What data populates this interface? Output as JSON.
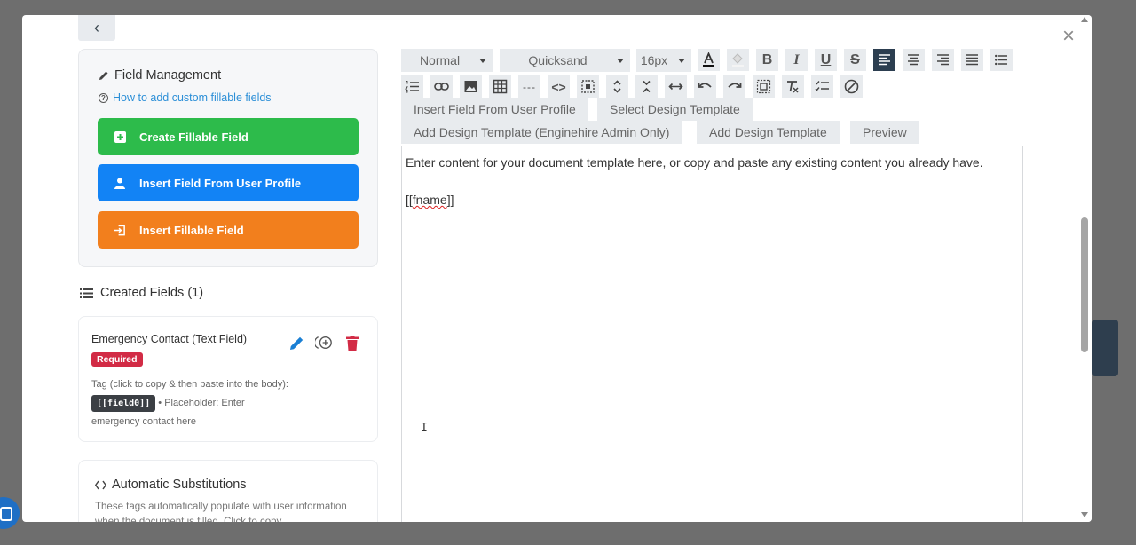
{
  "field_management": {
    "title": "Field Management",
    "help_link": "How to add custom fillable fields",
    "buttons": {
      "create": "Create Fillable Field",
      "insert_profile": "Insert Field From User Profile",
      "insert_fillable": "Insert Fillable Field"
    }
  },
  "created_fields": {
    "heading": "Created Fields (1)",
    "items": [
      {
        "name": "Emergency Contact (Text Field)",
        "badge": "Required",
        "desc_prefix": "Tag (click to copy & then paste into the body):",
        "tag": "[[field0]]",
        "desc_suffix": "• Placeholder: Enter emergency contact here"
      }
    ]
  },
  "substitutions": {
    "title": "Automatic Substitutions",
    "desc": "These tags automatically populate with user information when the document is filled. Click to copy"
  },
  "toolbar": {
    "format": "Normal",
    "font": "Quicksand",
    "size": "16px",
    "bold_glyph": "B",
    "italic_glyph": "I",
    "underline_glyph": "U",
    "strike_glyph": "S",
    "hr_glyph": "---",
    "code_glyph": "<>"
  },
  "tabs": {
    "insert_profile": "Insert Field From User Profile",
    "select_design": "Select Design Template",
    "add_design_admin": "Add Design Template (Enginehire Admin Only)",
    "add_design": "Add Design Template",
    "preview": "Preview"
  },
  "editor": {
    "line1": "Enter content for your document template here, or copy and paste any existing content you already have.",
    "line2_prefix": "[[",
    "line2_word": "fname",
    "line2_suffix": "]]"
  },
  "colors": {
    "green": "#2dbb4b",
    "blue": "#1283f5",
    "orange": "#f27f1d",
    "badge_red": "#d22b45",
    "active_toolbar": "#2c3e50"
  },
  "icons": {
    "close": "×",
    "back": "‹",
    "cursor": "I"
  }
}
